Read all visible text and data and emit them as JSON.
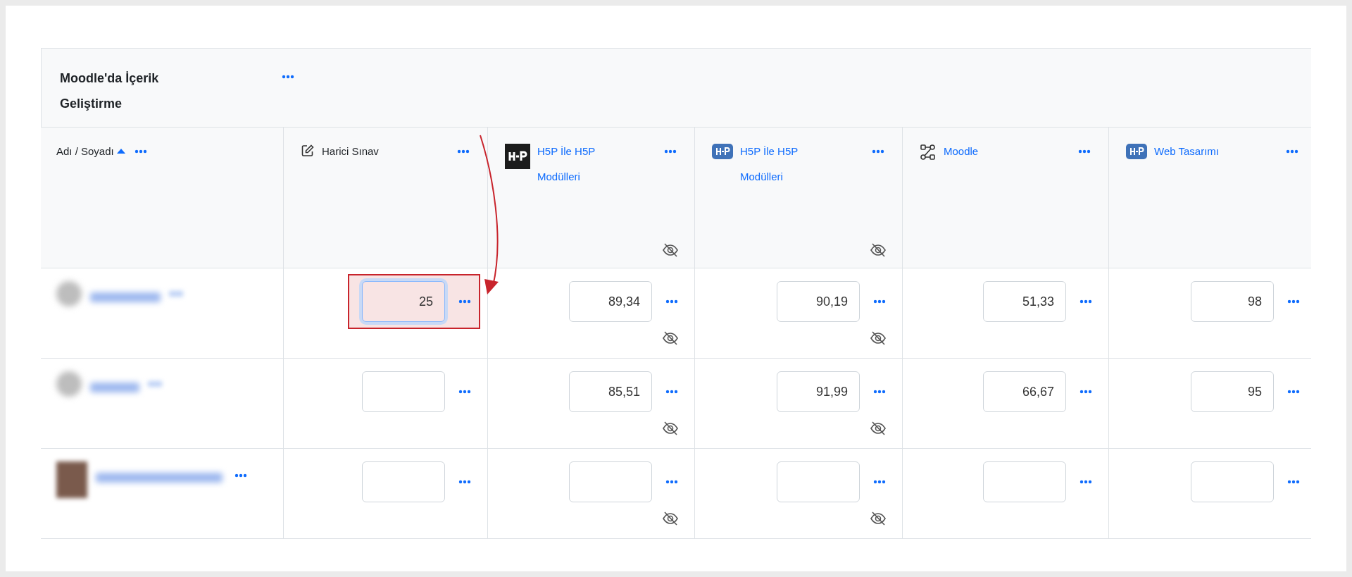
{
  "category": {
    "title": "Moodle'da İçerik Geliştirme"
  },
  "name_column": {
    "label": "Adı / Soyadı",
    "sorted_ascending": true
  },
  "columns": [
    {
      "label": "Harici Sınav",
      "kind": "edit",
      "link": false,
      "hidden": false
    },
    {
      "label": "H5P İle H5P Modülleri",
      "kind": "h5p-dark",
      "link": true,
      "hidden": true
    },
    {
      "label": "H5P İle H5P Modülleri",
      "kind": "h5p",
      "link": true,
      "hidden": true
    },
    {
      "label": "Moodle",
      "kind": "workflow",
      "link": true,
      "hidden": false
    },
    {
      "label": "Web Tasarımı",
      "kind": "h5p",
      "link": true,
      "hidden": false
    }
  ],
  "rows": [
    {
      "kind": "plain",
      "menu_visible": false,
      "grades": [
        {
          "value": "25",
          "highlighted": true
        },
        {
          "value": "89,34",
          "highlighted": false
        },
        {
          "value": "90,19",
          "highlighted": false
        },
        {
          "value": "51,33",
          "highlighted": false
        },
        {
          "value": "98",
          "highlighted": false
        }
      ]
    },
    {
      "kind": "plain",
      "menu_visible": false,
      "grades": [
        {
          "highlighted": false
        },
        {
          "value": "85,51",
          "highlighted": false
        },
        {
          "value": "91,99",
          "highlighted": false
        },
        {
          "value": "66,67",
          "highlighted": false
        },
        {
          "value": "95",
          "highlighted": false
        }
      ]
    },
    {
      "kind": "photo",
      "menu_visible": true,
      "grades": [
        {
          "highlighted": false
        },
        {
          "highlighted": false
        },
        {
          "highlighted": false
        },
        {
          "highlighted": false
        },
        {
          "highlighted": false
        }
      ]
    }
  ]
}
